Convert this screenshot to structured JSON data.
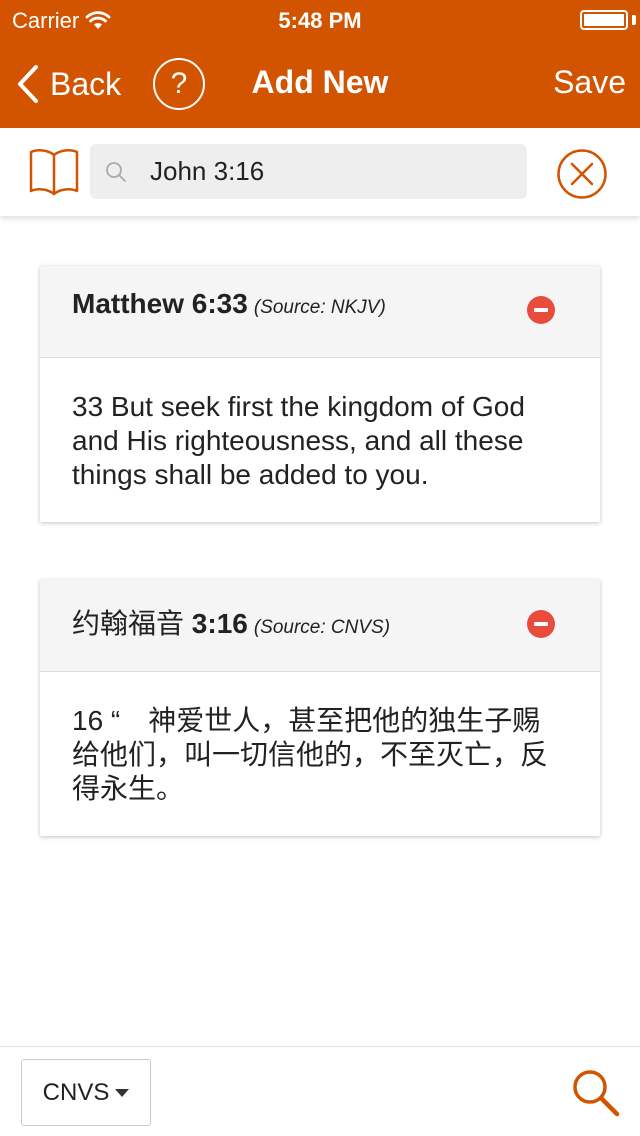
{
  "status": {
    "carrier": "Carrier",
    "time": "5:48 PM",
    "battery_level": 1.0
  },
  "nav": {
    "back_label": "Back",
    "help_label": "?",
    "title": "Add New",
    "save_label": "Save"
  },
  "search": {
    "value": "John 3:16",
    "placeholder": ""
  },
  "verses": [
    {
      "reference": "Matthew 6:33",
      "source": "(Source: NKJV)",
      "text": "33 But seek first the kingdom of God and His righteousness, and all these things shall be added to you."
    },
    {
      "book": "约翰福音",
      "reference": "3:16",
      "source": "(Source: CNVS)",
      "text": "16 “　神爱世人，甚至把他的独生子赐给他们，叫一切信他的，不至灭亡，反得永生。"
    }
  ],
  "bottom": {
    "version": "CNVS"
  },
  "colors": {
    "accent": "#d35400",
    "remove": "#e74c3c"
  },
  "icons": [
    "wifi-icon",
    "battery-icon",
    "chevron-left-icon",
    "help-icon",
    "book-icon",
    "search-icon",
    "clear-icon",
    "remove-icon",
    "caret-down-icon",
    "magnifier-icon"
  ]
}
